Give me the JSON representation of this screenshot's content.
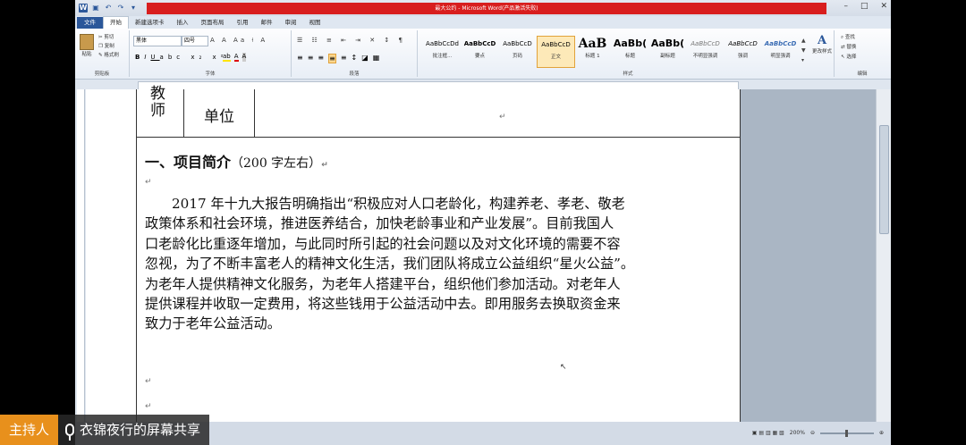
{
  "window": {
    "title": "最大公约 - Microsoft Word(产品激活失败)",
    "controls": [
      "–",
      "□",
      "✕"
    ]
  },
  "ribbon": {
    "tabs": [
      "文件",
      "开始",
      "新建选项卡",
      "插入",
      "页面布局",
      "引用",
      "邮件",
      "审阅",
      "视图"
    ],
    "active_tab": "开始",
    "clipboard": {
      "paste": "粘贴",
      "cut": "剪切",
      "copy": "复制",
      "format_painter": "格式刷",
      "label": "剪贴板"
    },
    "font": {
      "name": "黑体",
      "size": "四号",
      "label": "字体"
    },
    "paragraph": {
      "label": "段落"
    },
    "styles": {
      "label": "样式",
      "items": [
        {
          "sample": "AaBbCcDd",
          "name": "批注框..."
        },
        {
          "sample": "AaBbCcD",
          "name": "要点"
        },
        {
          "sample": "AaBbCcD",
          "name": "页码"
        },
        {
          "sample": "AaBbCcD",
          "name": "正文"
        },
        {
          "sample": "AaB",
          "name": "标题 1"
        },
        {
          "sample": "AaBb(",
          "name": "标题"
        },
        {
          "sample": "AaBb(",
          "name": "副标题"
        },
        {
          "sample": "AaBbCcD",
          "name": "不明显强调"
        },
        {
          "sample": "AaBbCcD",
          "name": "强调"
        },
        {
          "sample": "AaBbCcD",
          "name": "明显强调"
        }
      ],
      "change": "更改样式"
    },
    "editing": {
      "find": "查找",
      "replace": "替换",
      "select": "选择",
      "label": "编辑"
    }
  },
  "document": {
    "table_cell_teacher": "教师",
    "table_cell_unit": "单位",
    "heading": "一、项目简介",
    "heading_note": "（200 字左右）",
    "paragraph_lines": [
      "2017 年十九大报告明确指出“积极应对人口老龄化，构建养老、孝老、敬老",
      "政策体系和社会环境，推进医养结合，加快老龄事业和产业发展”。目前我国人",
      "口老龄化比重逐年增加，与此同时所引起的社会问题以及对文化环境的需要不容",
      "忽视，为了不断丰富老人的精神文化生活，我们团队将成立公益组织“星火公益”。",
      "为老年人提供精神文化服务，为老年人搭建平台，组织他们参加活动。对老年人",
      "提供课程并收取一定费用，将这些钱用于公益活动中去。即用服务去换取资金来",
      "致力于老年公益活动。"
    ]
  },
  "status": {
    "zoom": "200%"
  },
  "overlay": {
    "host_label": "主持人",
    "share_label": "衣锦夜行的屏幕共享"
  }
}
